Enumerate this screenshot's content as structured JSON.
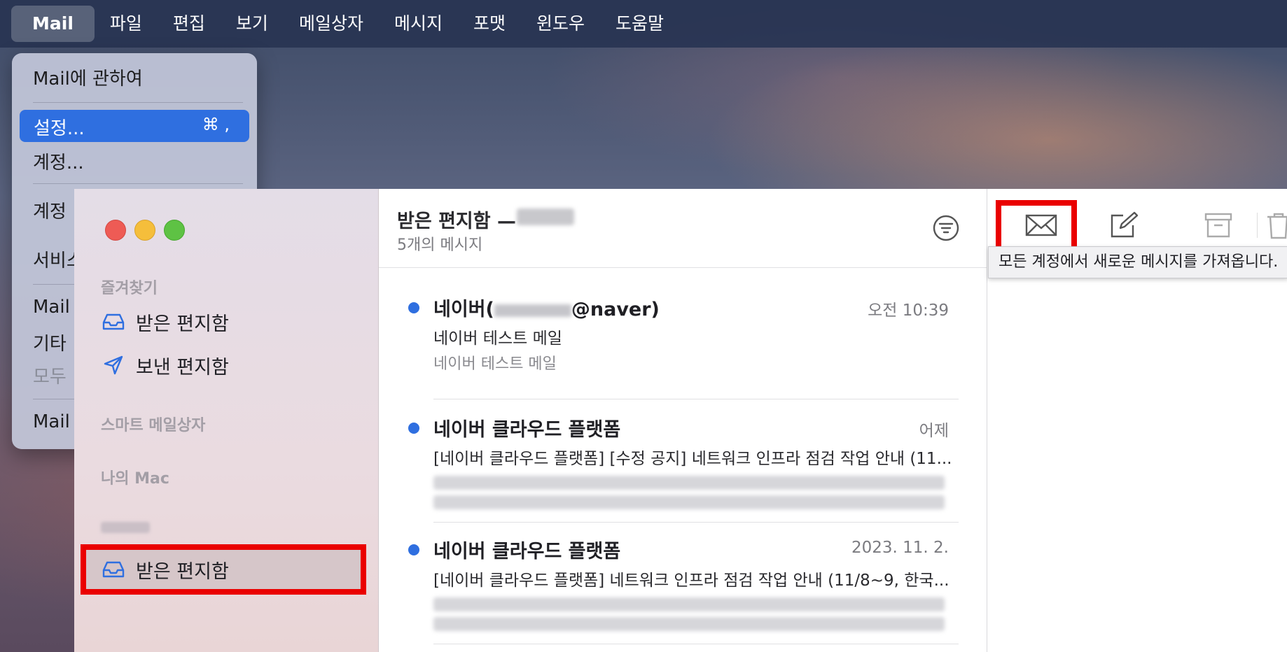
{
  "menubar": {
    "apple": "",
    "items": [
      "Mail",
      "파일",
      "편집",
      "보기",
      "메일상자",
      "메시지",
      "포맷",
      "윈도우",
      "도움말"
    ]
  },
  "app_menu": {
    "about": "Mail에 관하여",
    "settings": "설정...",
    "settings_shortcut": "⌘ ,",
    "accounts": "계정...",
    "accounts2": "계정",
    "services": "서비스",
    "hide_mail": "Mail",
    "hide_others": "기타",
    "show_all": "모두",
    "quit": "Mail"
  },
  "sidebar": {
    "favorites_header": "즐겨찾기",
    "inbox": "받은 편지함",
    "sent": "보낸 편지함",
    "smart_header": "스마트 메일상자",
    "mac_header": "나의 Mac",
    "account_inbox": "받은 편지함"
  },
  "list": {
    "title": "받은 편지함 —",
    "count": "5개의 메시지",
    "messages": [
      {
        "sender_prefix": "네이버(",
        "sender_suffix": "@naver)",
        "date": "오전 10:39",
        "subject": "네이버 테스트 메일",
        "preview": "네이버 테스트 메일"
      },
      {
        "sender": "네이버 클라우드 플랫폼",
        "date": "어제",
        "subject": "[네이버 클라우드 플랫폼] [수정 공지] 네트워크 인프라 점검 작업 안내 (11..."
      },
      {
        "sender": "네이버 클라우드 플랫폼",
        "date": "2023. 11. 2.",
        "subject": "[네이버 클라우드 플랫폼] 네트워크 인프라 점검 작업 안내 (11/8~9, 한국..."
      }
    ]
  },
  "toolbar": {
    "tooltip": "모든 계정에서 새로운 메시지를 가져옵니다."
  },
  "colors": {
    "accent": "#2f6fe0",
    "highlight": "#ea0000"
  },
  "icons": [
    "get-mail-icon",
    "compose-icon",
    "archive-icon",
    "trash-icon",
    "filter-icon",
    "inbox-icon",
    "sent-icon"
  ]
}
